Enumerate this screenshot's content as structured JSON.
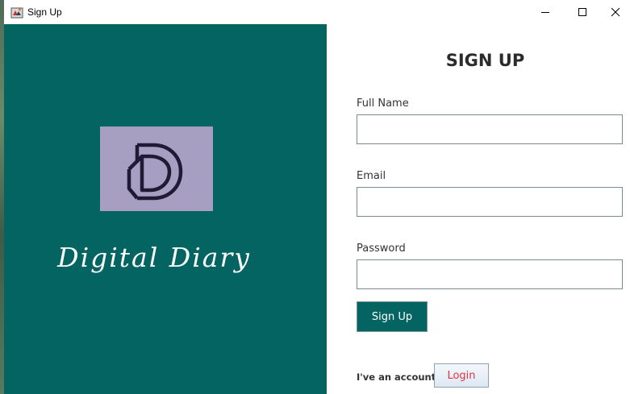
{
  "window": {
    "title": "Sign Up"
  },
  "brand": {
    "name": "Digital Diary",
    "logo_icon": "double-d-logo-icon",
    "panel_color": "#036462",
    "logo_bg_color": "#a69fc2"
  },
  "form": {
    "heading": "SIGN UP",
    "fields": [
      {
        "label": "Full Name",
        "value": "",
        "placeholder": ""
      },
      {
        "label": "Email",
        "value": "",
        "placeholder": ""
      },
      {
        "label": "Password",
        "value": "",
        "placeholder": ""
      }
    ],
    "signup_label": "Sign Up",
    "account_prompt": "I've an account",
    "login_label": "Login",
    "login_text_color": "#e4343f"
  }
}
